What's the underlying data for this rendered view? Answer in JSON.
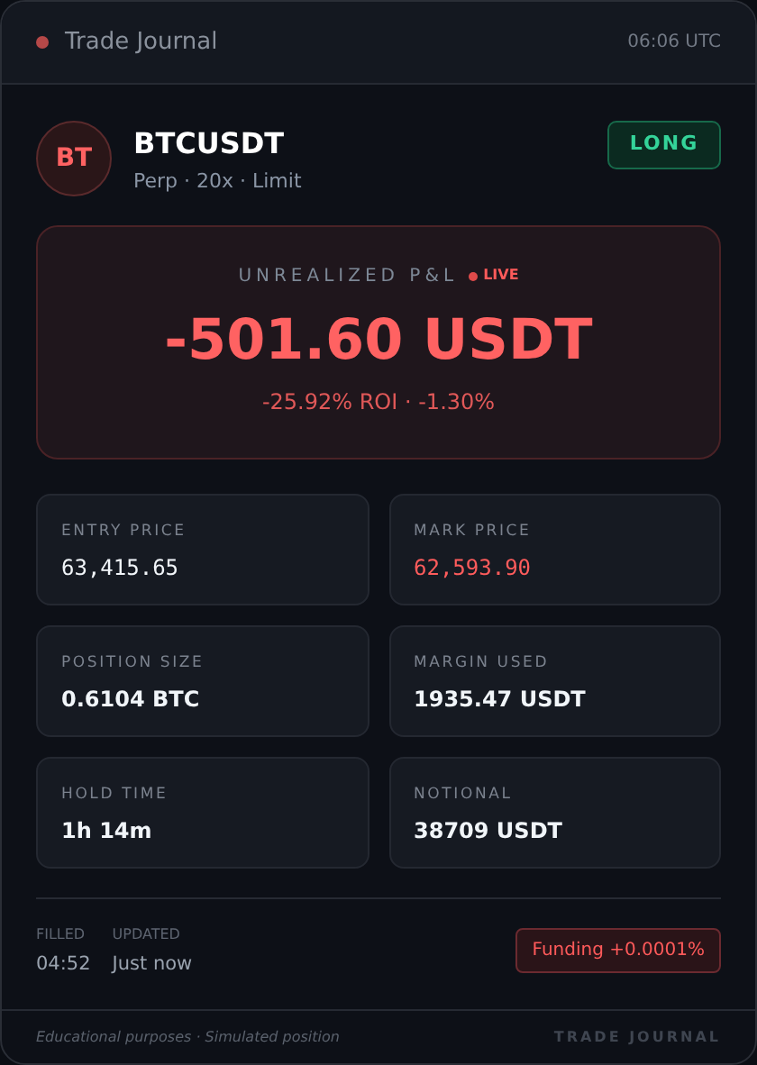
{
  "header": {
    "title": "Trade Journal",
    "time": "06:06 UTC"
  },
  "position": {
    "avatar": "BT",
    "symbol": "BTCUSDT",
    "details": "Perp · 20x · Limit",
    "side": "LONG"
  },
  "pnl": {
    "label": "UNREALIZED P&L",
    "live": "LIVE",
    "value": "-501.60 USDT",
    "sub": "-25.92% ROI · -1.30%"
  },
  "stats": [
    {
      "label": "ENTRY PRICE",
      "value": "63,415.65",
      "kind": "mono",
      "color": "#f1f5f9"
    },
    {
      "label": "MARK PRICE",
      "value": "62,593.90",
      "kind": "mono",
      "color": "#ff5c5c"
    },
    {
      "label": "POSITION SIZE",
      "value": "0.6104 BTC",
      "kind": "plain",
      "color": "#f1f5f9"
    },
    {
      "label": "MARGIN USED",
      "value": "1935.47 USDT",
      "kind": "plain",
      "color": "#f1f5f9"
    },
    {
      "label": "HOLD TIME",
      "value": "1h 14m",
      "kind": "plain",
      "color": "#f1f5f9"
    },
    {
      "label": "NOTIONAL",
      "value": "38709 USDT",
      "kind": "plain",
      "color": "#f1f5f9"
    }
  ],
  "times": [
    {
      "label": "FILLED",
      "value": "04:52"
    },
    {
      "label": "UPDATED",
      "value": "Just now"
    }
  ],
  "funding": {
    "text": "Funding +0.0001%"
  },
  "footer": {
    "note": "Educational purposes · Simulated position",
    "brand": "TRADE JOURNAL"
  }
}
